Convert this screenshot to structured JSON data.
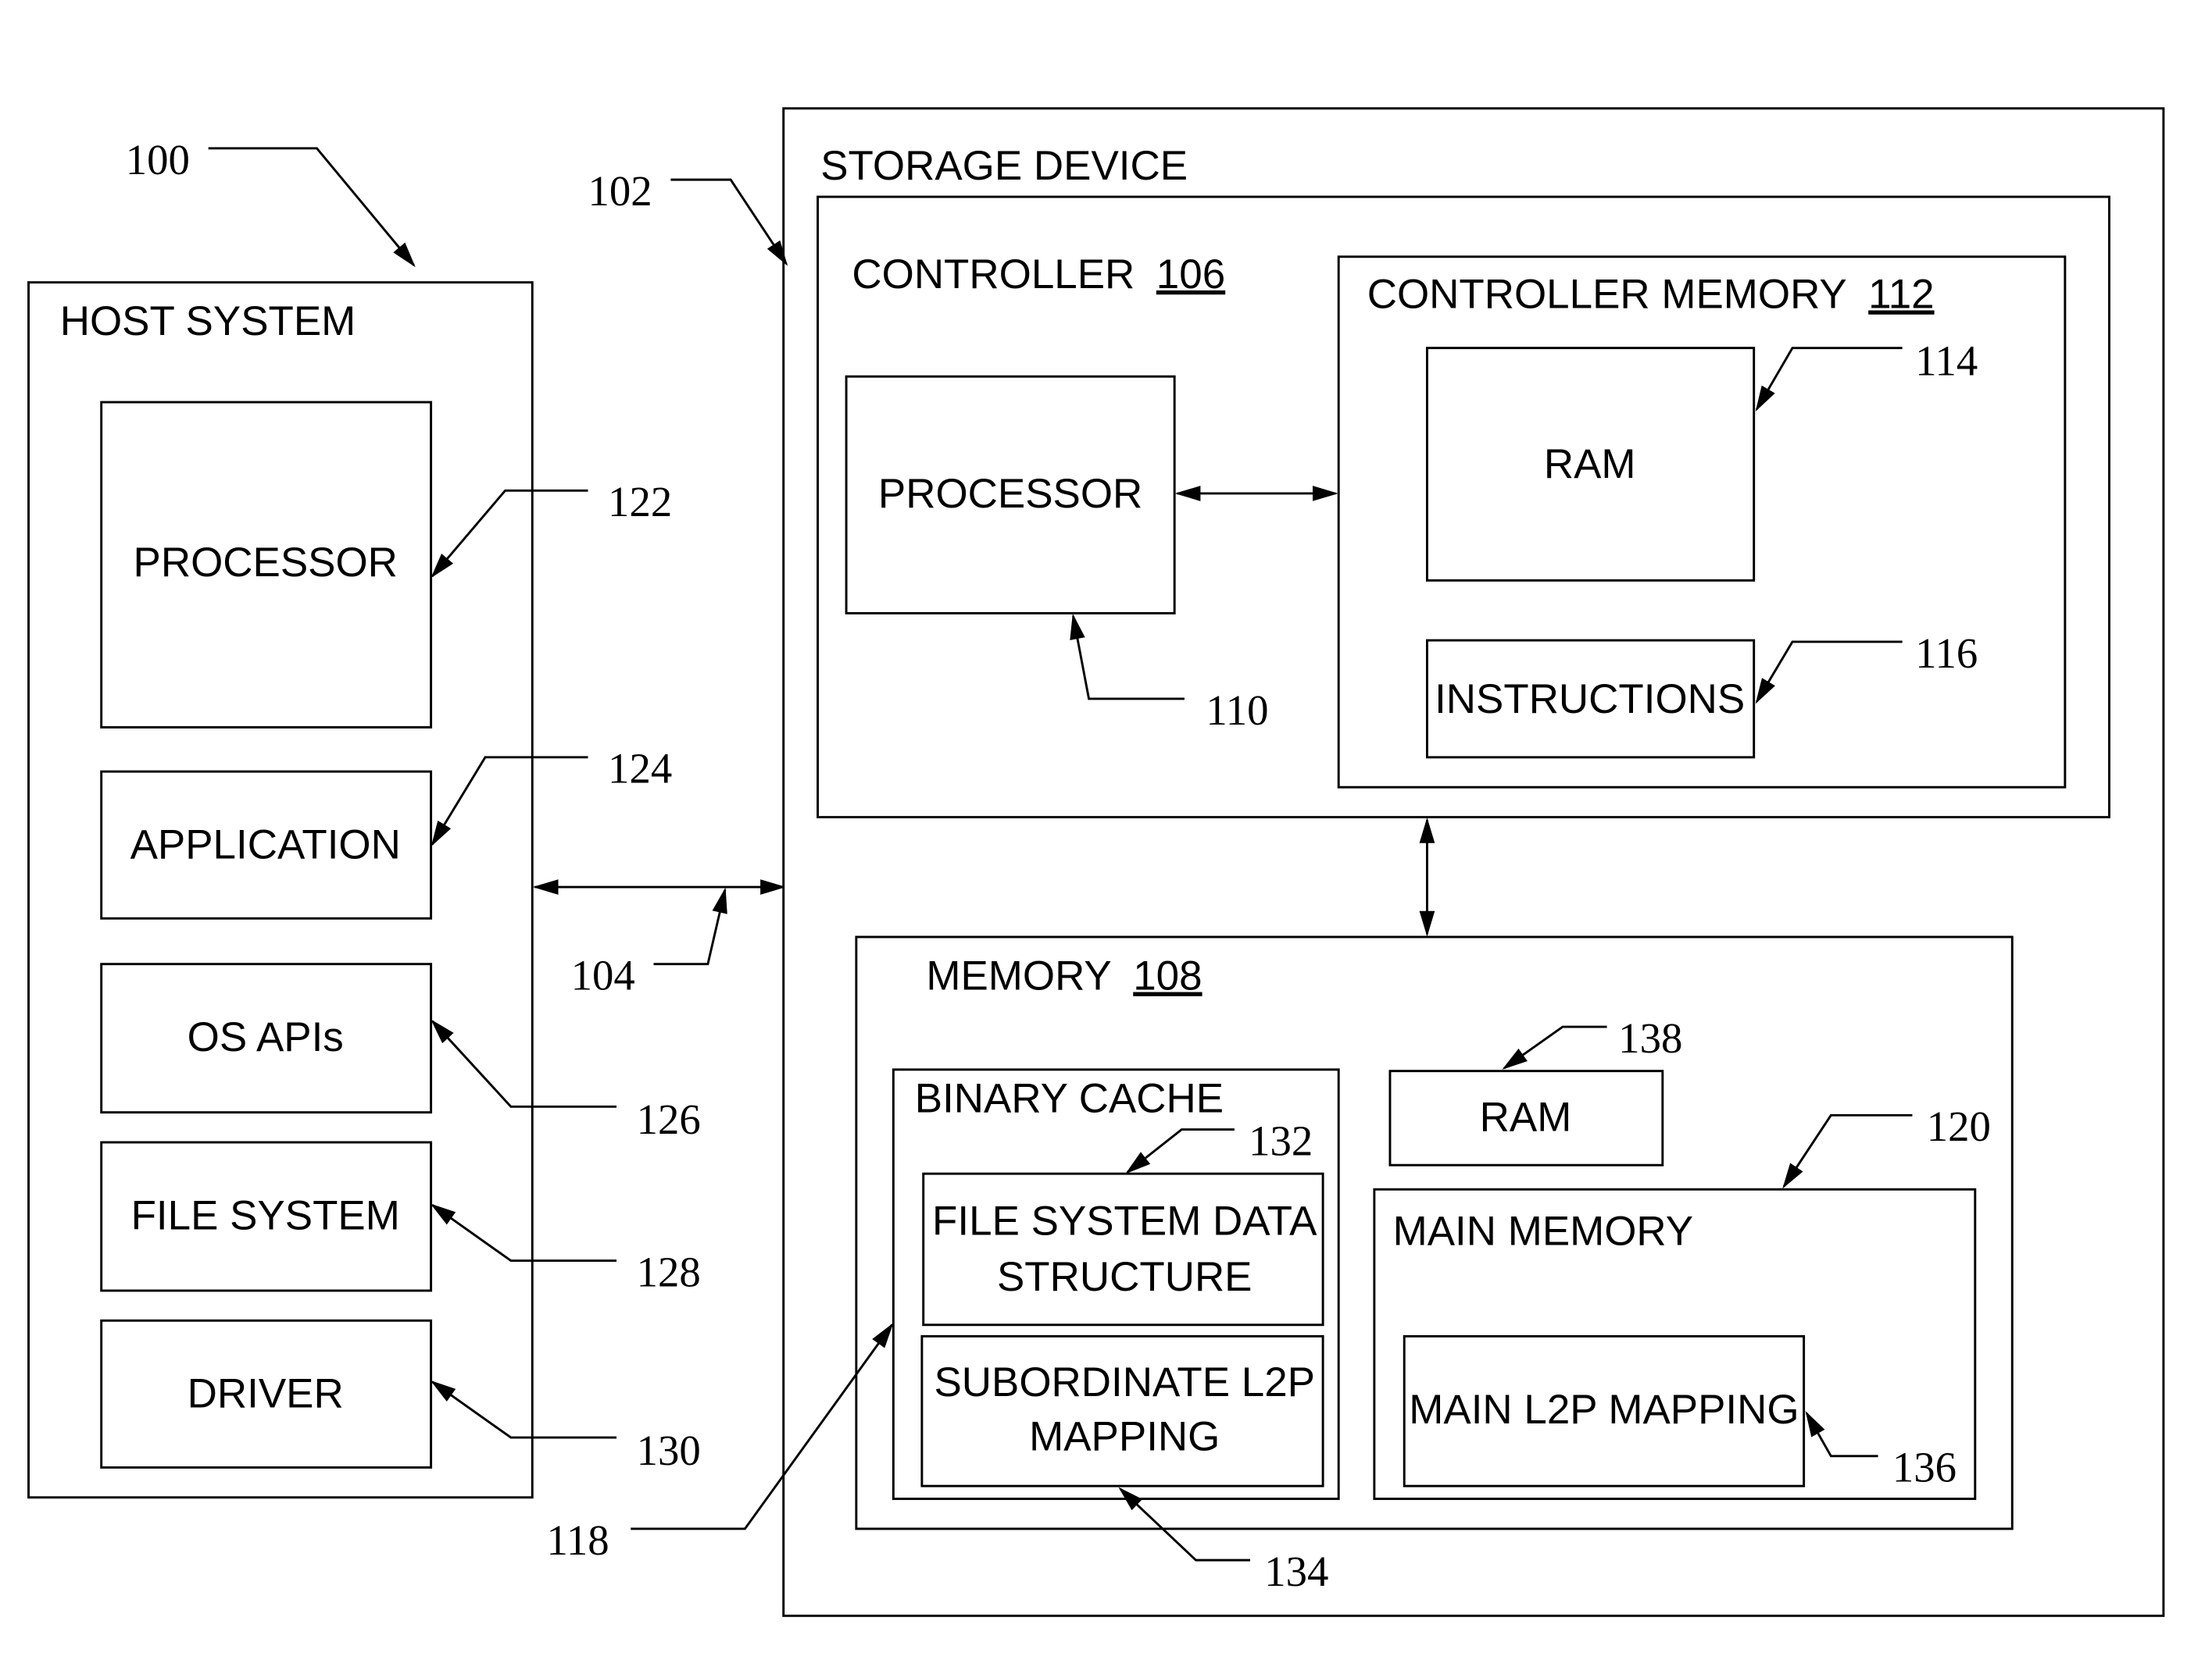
{
  "figure_ref": "100",
  "host_system": {
    "title": "HOST SYSTEM",
    "components": [
      {
        "label": "PROCESSOR",
        "ref": "122"
      },
      {
        "label": "APPLICATION",
        "ref": "124"
      },
      {
        "label": "OS APIs",
        "ref": "126"
      },
      {
        "label": "FILE SYSTEM",
        "ref": "128"
      },
      {
        "label": "DRIVER",
        "ref": "130"
      }
    ]
  },
  "interface": {
    "ref": "104"
  },
  "storage_device": {
    "title": "STORAGE DEVICE",
    "ref": "102",
    "controller": {
      "title": "CONTROLLER",
      "ref": "106",
      "processor": {
        "label": "PROCESSOR",
        "ref": "110"
      },
      "controller_memory": {
        "title": "CONTROLLER MEMORY",
        "ref": "112",
        "ram": {
          "label": "RAM",
          "ref": "114"
        },
        "instructions": {
          "label": "INSTRUCTIONS",
          "ref": "116"
        }
      }
    },
    "memory": {
      "title": "MEMORY",
      "ref": "108",
      "binary_cache": {
        "title": "BINARY CACHE",
        "ref": "118",
        "fs_data_structure": {
          "line1": "FILE SYSTEM DATA",
          "line2": "STRUCTURE",
          "ref": "132"
        },
        "subordinate_l2p": {
          "line1": "SUBORDINATE L2P",
          "line2": "MAPPING",
          "ref": "134"
        }
      },
      "ram": {
        "label": "RAM",
        "ref": "138"
      },
      "main_memory": {
        "title": "MAIN MEMORY",
        "ref": "120",
        "main_l2p": {
          "label": "MAIN L2P MAPPING",
          "ref": "136"
        }
      }
    }
  }
}
